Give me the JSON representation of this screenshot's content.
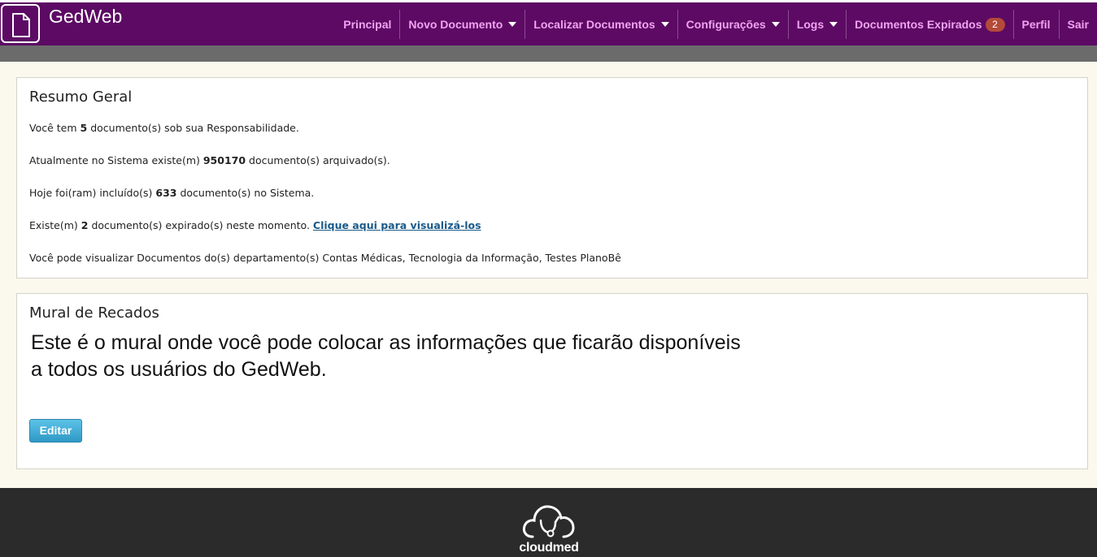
{
  "brand": "GedWeb",
  "nav": [
    {
      "label": "Principal",
      "dropdown": false
    },
    {
      "label": "Novo Documento",
      "dropdown": true
    },
    {
      "label": "Localizar Documentos",
      "dropdown": true
    },
    {
      "label": "Configurações",
      "dropdown": true
    },
    {
      "label": "Logs",
      "dropdown": true
    },
    {
      "label": "Documentos Expirados",
      "badge": "2"
    },
    {
      "label": "Perfil"
    },
    {
      "label": "Sair"
    }
  ],
  "summary": {
    "title": "Resumo Geral",
    "line1": {
      "pre": "Você tem ",
      "value": "5",
      "post": " documento(s) sob sua Responsabilidade."
    },
    "line2": {
      "pre": "Atualmente no Sistema existe(m) ",
      "value": "950170",
      "post": " documento(s) arquivado(s)."
    },
    "line3": {
      "pre": "Hoje foi(ram) incluído(s) ",
      "value": "633",
      "post": " documento(s) no Sistema."
    },
    "line4": {
      "pre": "Existe(m) ",
      "value": "2",
      "post": " documento(s) expirado(s) neste momento. ",
      "link": "Clique aqui para visualizá-los"
    },
    "line5": "Você pode visualizar Documentos do(s) departamento(s) Contas Médicas, Tecnologia da Informação, Testes PlanoBê"
  },
  "mural": {
    "title": "Mural de Recados",
    "text_line1": "Este é o mural onde você pode colocar as informações que ficarão disponíveis",
    "text_line2": "a todos os usuários do GedWeb.",
    "edit_label": "Editar"
  },
  "footer": {
    "logo_text": "cloudmed"
  },
  "colors": {
    "topbar": "#5c0a64",
    "nav_text": "#f0a3f0",
    "badge": "#b44a38",
    "button": "#2f99c5",
    "footer": "#2b2b2b"
  },
  "icons": {
    "logo": "document-icon",
    "footer": "cloud-stethoscope-icon"
  }
}
